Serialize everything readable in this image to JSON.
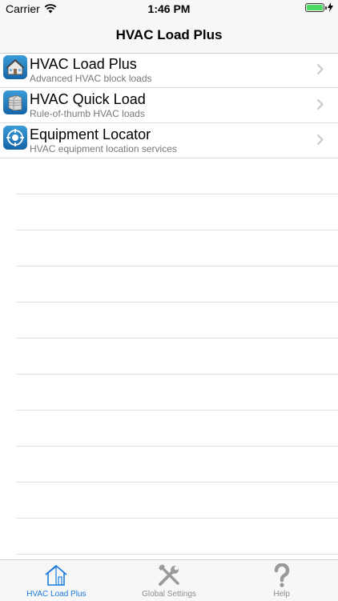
{
  "status_bar": {
    "carrier": "Carrier",
    "time": "1:46 PM",
    "battery_level": 1.0
  },
  "nav": {
    "title": "HVAC Load Plus"
  },
  "list": {
    "items": [
      {
        "title": "HVAC Load Plus",
        "subtitle": "Advanced HVAC block loads",
        "icon": "house-icon"
      },
      {
        "title": "HVAC Quick Load",
        "subtitle": "Rule-of-thumb HVAC loads",
        "icon": "building-icon"
      },
      {
        "title": "Equipment Locator",
        "subtitle": "HVAC equipment location services",
        "icon": "locator-icon"
      }
    ]
  },
  "tabs": [
    {
      "label": "HVAC Load Plus",
      "icon": "house-outline-icon",
      "active": true
    },
    {
      "label": "Global Settings",
      "icon": "tools-icon",
      "active": false
    },
    {
      "label": "Help",
      "icon": "question-mark-icon",
      "active": false
    }
  ],
  "colors": {
    "accent": "#1b7ae0",
    "battery": "#4cd964",
    "icon_bg": "#1e78c2"
  }
}
